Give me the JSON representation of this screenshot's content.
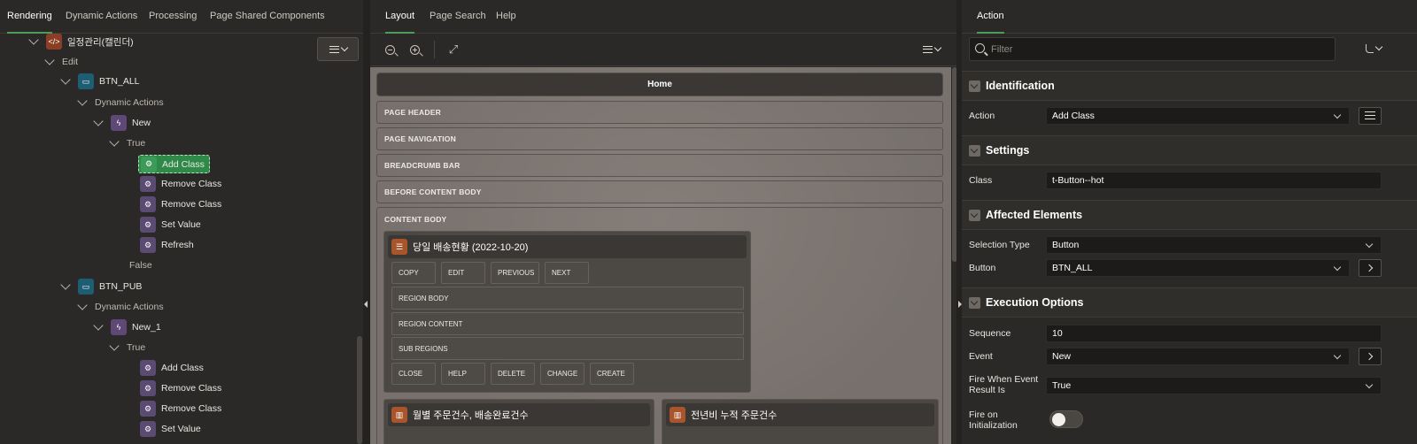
{
  "left": {
    "tabs": [
      "Rendering",
      "Dynamic Actions",
      "Processing",
      "Page Shared Components"
    ],
    "tree": [
      {
        "label": "일정관리(캘린더)",
        "icon": "page-code-icon"
      },
      {
        "label": "Edit"
      },
      {
        "label": "BTN_ALL",
        "icon": "button-icon"
      },
      {
        "label": "Dynamic Actions"
      },
      {
        "label": "New",
        "icon": "lightning-icon"
      },
      {
        "label": "True"
      },
      {
        "label": "Add Class",
        "icon": "action-gear-icon",
        "selected": true
      },
      {
        "label": "Remove Class",
        "icon": "action-gear-icon"
      },
      {
        "label": "Remove Class",
        "icon": "action-gear-icon"
      },
      {
        "label": "Set Value",
        "icon": "action-gear-icon"
      },
      {
        "label": "Refresh",
        "icon": "action-gear-icon"
      },
      {
        "label": "False"
      },
      {
        "label": "BTN_PUB",
        "icon": "button-icon"
      },
      {
        "label": "Dynamic Actions"
      },
      {
        "label": "New_1",
        "icon": "lightning-icon"
      },
      {
        "label": "True"
      },
      {
        "label": "Add Class",
        "icon": "action-gear-icon"
      },
      {
        "label": "Remove Class",
        "icon": "action-gear-icon"
      },
      {
        "label": "Remove Class",
        "icon": "action-gear-icon"
      },
      {
        "label": "Set Value",
        "icon": "action-gear-icon"
      }
    ]
  },
  "middle": {
    "tabs": [
      "Layout",
      "Page Search",
      "Help"
    ],
    "page_title": "Home",
    "slots": [
      "PAGE HEADER",
      "PAGE NAVIGATION",
      "BREADCRUMB BAR",
      "BEFORE CONTENT BODY",
      "CONTENT BODY"
    ],
    "region1": {
      "title": "당일 배송현황 (2022-10-20)",
      "top_buttons": [
        "COPY",
        "EDIT",
        "PREVIOUS",
        "NEXT"
      ],
      "slots": [
        "REGION BODY",
        "REGION CONTENT",
        "SUB REGIONS"
      ],
      "bottom_buttons": [
        "CLOSE",
        "HELP",
        "DELETE",
        "CHANGE",
        "CREATE"
      ]
    },
    "region2": {
      "title": "월별 주문건수, 배송완료건수"
    },
    "region3": {
      "title": "전년비 누적 주문건수"
    }
  },
  "right": {
    "tab": "Action",
    "filter_placeholder": "Filter",
    "sections": {
      "identification": "Identification",
      "settings": "Settings",
      "affected": "Affected Elements",
      "execution": "Execution Options"
    },
    "props": {
      "action": {
        "label": "Action",
        "value": "Add Class"
      },
      "class": {
        "label": "Class",
        "value": "t-Button--hot"
      },
      "selection_type": {
        "label": "Selection Type",
        "value": "Button"
      },
      "button": {
        "label": "Button",
        "value": "BTN_ALL"
      },
      "sequence": {
        "label": "Sequence",
        "value": "10"
      },
      "event": {
        "label": "Event",
        "value": "New"
      },
      "fire_when": {
        "label": "Fire When Event Result Is",
        "value": "True"
      },
      "fire_on_init": {
        "label": "Fire on Initialization",
        "value": false
      }
    }
  }
}
